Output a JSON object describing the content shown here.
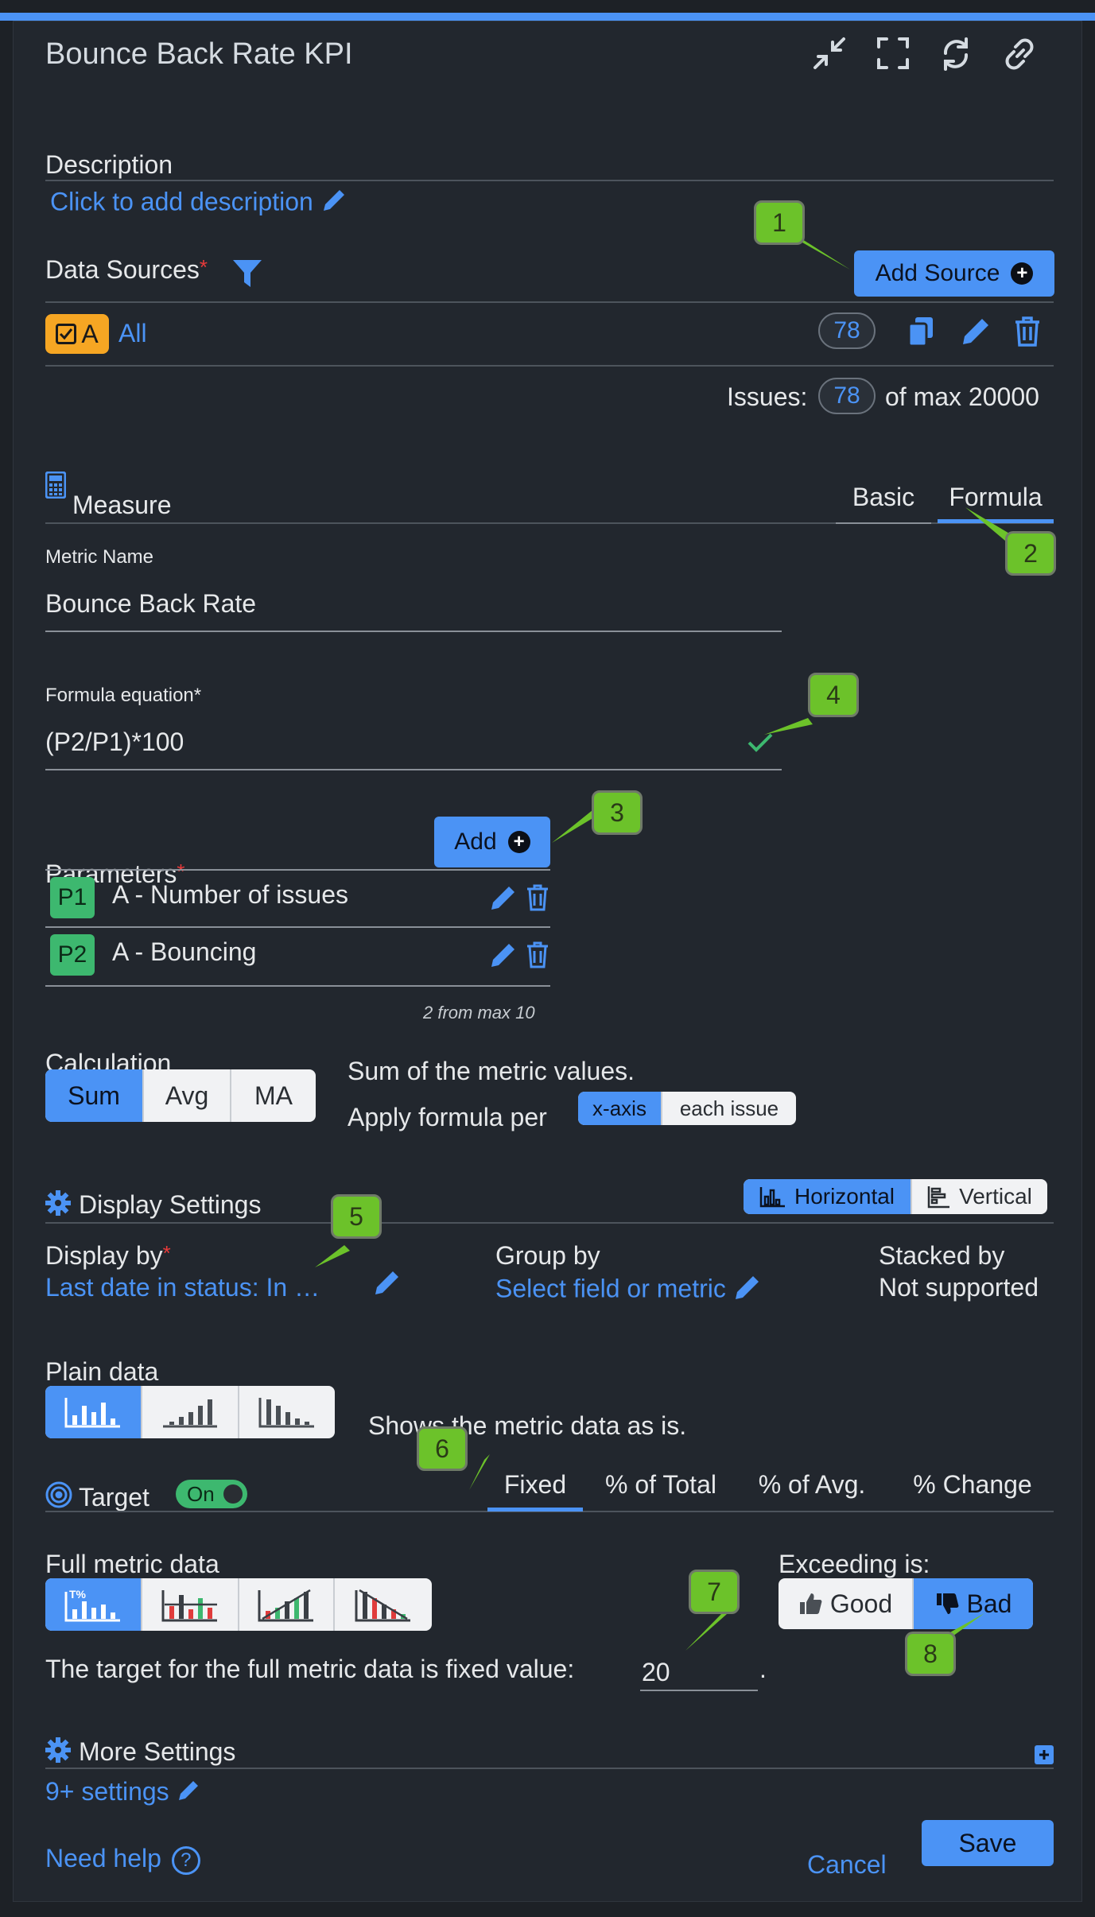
{
  "header": {
    "title": "Bounce Back Rate KPI"
  },
  "description": {
    "label": "Description",
    "placeholder_link": "Click to add description"
  },
  "data_sources": {
    "label": "Data Sources",
    "required_mark": "*",
    "add_button": "Add Source",
    "source": {
      "badge": "A",
      "name": "All",
      "count": "78"
    },
    "issues_label": "Issues:",
    "issues_count": "78",
    "issues_max": "of max 20000"
  },
  "measure": {
    "label": "Measure",
    "tabs": [
      "Basic",
      "Formula"
    ],
    "active_tab": "Formula",
    "metric_name_label": "Metric Name",
    "metric_name_value": "Bounce Back Rate",
    "formula_label": "Formula equation*",
    "formula_value": "(P2/P1)*100",
    "parameters_label": "Parameters",
    "required_mark": "*",
    "add_button": "Add",
    "parameters": [
      {
        "badge": "P1",
        "name": "A - Number of issues"
      },
      {
        "badge": "P2",
        "name": "A - Bouncing"
      }
    ],
    "param_limit": "2 from max 10",
    "calculation_label": "Calculation",
    "calculation_options": [
      "Sum",
      "Avg",
      "MA"
    ],
    "calculation_selected": "Sum",
    "calculation_desc": "Sum of the metric values.",
    "apply_formula_label": "Apply formula per",
    "apply_options": [
      "x-axis",
      "each issue"
    ],
    "apply_selected": "x-axis"
  },
  "display_settings": {
    "label": "Display Settings",
    "orientation_options": [
      "Horizontal",
      "Vertical"
    ],
    "orientation_selected": "Horizontal",
    "display_by_label": "Display by",
    "required_mark": "*",
    "display_by_value": "Last date in status: In …",
    "group_by_label": "Group by",
    "group_by_value": "Select field or metric",
    "stacked_by_label": "Stacked by",
    "stacked_by_value": "Not supported",
    "plain_data_label": "Plain data",
    "plain_data_desc": "Shows the metric data as is."
  },
  "target": {
    "label": "Target",
    "toggle": "On",
    "tabs": [
      "Fixed",
      "% of Total",
      "% of Avg.",
      "% Change"
    ],
    "active_tab": "Fixed",
    "full_metric_label": "Full metric data",
    "exceeding_label": "Exceeding is:",
    "exceeding_options": [
      "Good",
      "Bad"
    ],
    "exceeding_selected": "Bad",
    "fixed_text": "The target for the full metric data is fixed value:",
    "fixed_value": "20",
    "fixed_suffix": "."
  },
  "more_settings": {
    "label": "More Settings",
    "link": "9+ settings"
  },
  "footer": {
    "help": "Need help",
    "cancel": "Cancel",
    "save": "Save"
  },
  "callouts": [
    "1",
    "2",
    "3",
    "4",
    "5",
    "6",
    "7",
    "8"
  ],
  "colors": {
    "accent": "#4b93f5",
    "callout": "#6cc22a",
    "badge": "#3db86f",
    "source_badge": "#f6a623"
  }
}
